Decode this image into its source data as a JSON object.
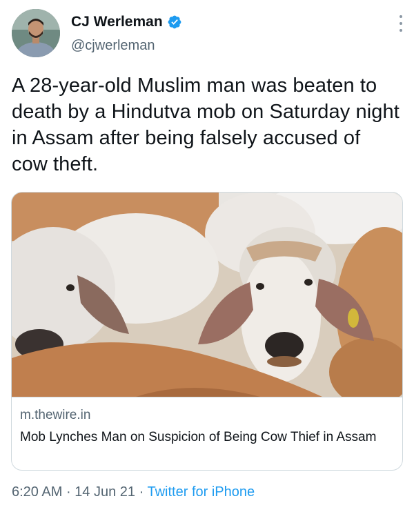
{
  "user": {
    "name": "CJ Werleman",
    "handle": "@cjwerleman",
    "verified_color": "#1d9bf0"
  },
  "tweet": {
    "text": "A 28-year-old Muslim man was beaten to death by a Hindutva mob on Saturday night in Assam after being falsely accused of cow theft."
  },
  "card": {
    "image_icon": "cows-photo",
    "domain": "m.thewire.in",
    "title": "Mob Lynches Man on Suspicion of Being Cow Thief in Assam"
  },
  "meta": {
    "time": "6:20 AM",
    "separator": "·",
    "date": "14 Jun 21",
    "source": "Twitter for iPhone"
  }
}
